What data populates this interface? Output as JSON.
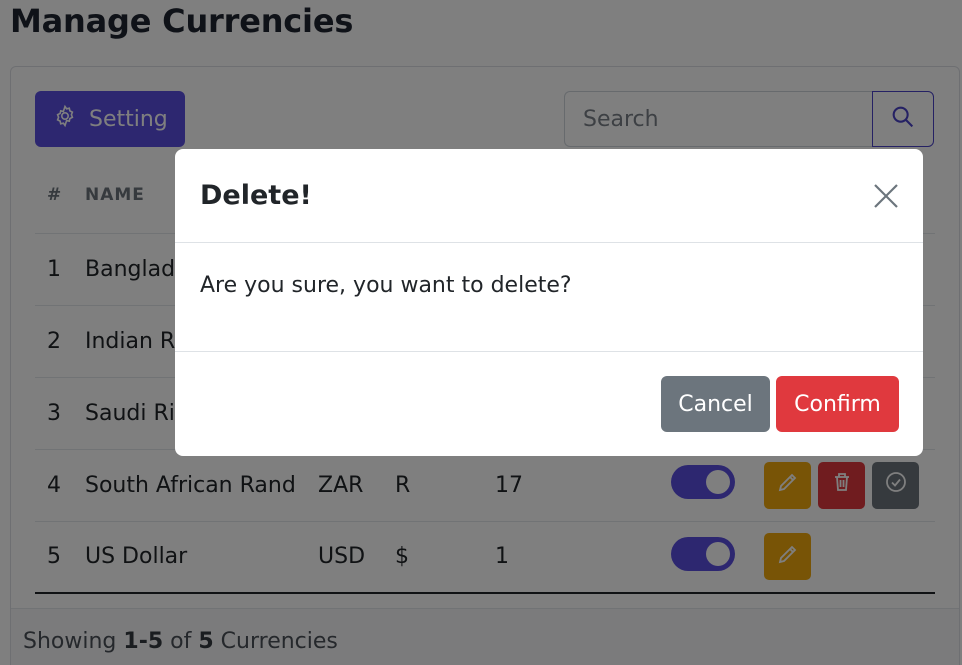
{
  "page": {
    "title": "Manage Currencies"
  },
  "toolbar": {
    "setting_label": "Setting",
    "search_placeholder": "Search"
  },
  "table": {
    "headers": [
      "#",
      "NAME"
    ],
    "rows": [
      {
        "index": "1",
        "name": "Banglade",
        "code": "",
        "symbol": "",
        "rate": "",
        "enabled": true
      },
      {
        "index": "2",
        "name": "Indian Ru",
        "code": "",
        "symbol": "",
        "rate": "",
        "enabled": true
      },
      {
        "index": "3",
        "name": "Saudi Riy",
        "code": "",
        "symbol": "",
        "rate": "",
        "enabled": true
      },
      {
        "index": "4",
        "name": "South African Rand",
        "code": "ZAR",
        "symbol": "R",
        "rate": "17",
        "enabled": true
      },
      {
        "index": "5",
        "name": "US Dollar",
        "code": "USD",
        "symbol": "$",
        "rate": "1",
        "enabled": true
      }
    ]
  },
  "footer": {
    "prefix": "Showing",
    "range": "1-5",
    "of": "of",
    "total": "5",
    "suffix": "Currencies"
  },
  "modal": {
    "title": "Delete!",
    "message": "Are you sure, you want to delete?",
    "cancel_label": "Cancel",
    "confirm_label": "Confirm"
  },
  "icons": {
    "setting": "gear-icon",
    "search": "search-icon",
    "edit": "pencil-icon",
    "delete": "trash-icon",
    "approve": "check-circle-icon",
    "close": "close-icon"
  },
  "colors": {
    "primary": "#5a4fe0",
    "warning": "#f0a80c",
    "danger": "#e0393e",
    "secondary": "#6c757d"
  }
}
